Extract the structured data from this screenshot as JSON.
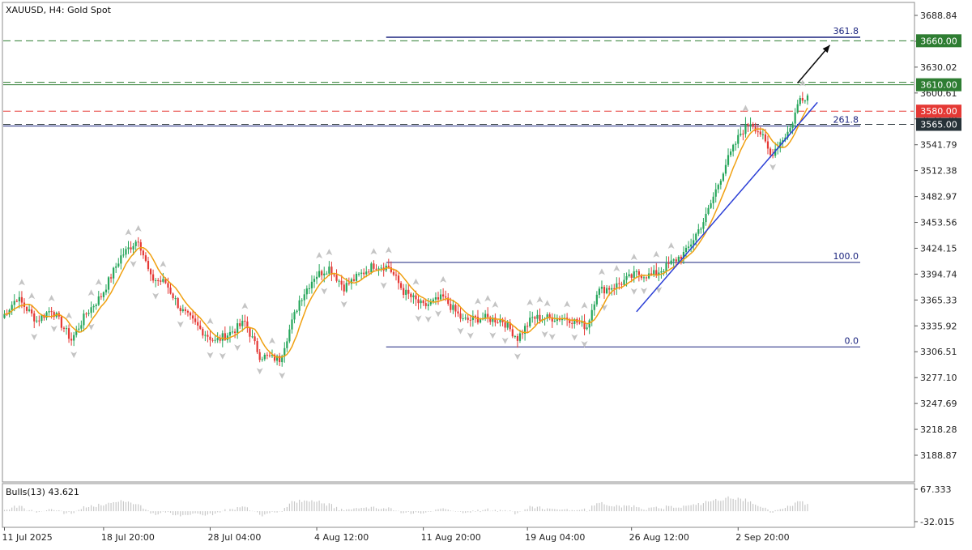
{
  "header": {
    "title": "XAUUSD, H4:  Gold Spot"
  },
  "colors": {
    "bull": "#26a65b",
    "bear": "#e53935",
    "ma": "#f0a010",
    "fib": "#1a237e",
    "trend": "#2b3fd6",
    "target": "#0a0a0a",
    "green_level": "#2e7d32",
    "red_level": "#e53935",
    "dark_level": "#263238",
    "histogram": "#c8c8c8",
    "fractal": "#c4c4c4"
  },
  "chart_data": {
    "type": "candlestick",
    "symbol": "XAUUSD",
    "timeframe": "H4",
    "title": "XAUUSD, H4:  Gold Spot",
    "ylim": [
      3170,
      3700
    ],
    "y_ticks": [
      "3688.84",
      "3659.43",
      "3630.02",
      "3600.61",
      "3571.20",
      "3541.79",
      "3512.38",
      "3482.97",
      "3453.56",
      "3424.15",
      "3394.74",
      "3365.33",
      "3335.92",
      "3306.51",
      "3277.10",
      "3247.69",
      "3218.28",
      "3188.87"
    ],
    "x_tick_labels": [
      "11 Jul 2025",
      "18 Jul 20:00",
      "28 Jul 04:00",
      "4 Aug 12:00",
      "11 Aug 20:00",
      "19 Aug 04:00",
      "26 Aug 12:00",
      "2 Sep 20:00"
    ],
    "x_tick_bar_index": [
      0,
      40,
      83,
      126,
      169,
      211,
      253,
      296
    ],
    "bar_count": 325,
    "anchors": [
      [
        0,
        3345
      ],
      [
        6,
        3368
      ],
      [
        14,
        3342
      ],
      [
        20,
        3355
      ],
      [
        28,
        3320
      ],
      [
        34,
        3350
      ],
      [
        40,
        3370
      ],
      [
        48,
        3415
      ],
      [
        55,
        3435
      ],
      [
        60,
        3390
      ],
      [
        66,
        3385
      ],
      [
        72,
        3355
      ],
      [
        80,
        3332
      ],
      [
        86,
        3318
      ],
      [
        92,
        3328
      ],
      [
        98,
        3340
      ],
      [
        104,
        3302
      ],
      [
        112,
        3298
      ],
      [
        120,
        3365
      ],
      [
        126,
        3392
      ],
      [
        132,
        3402
      ],
      [
        138,
        3380
      ],
      [
        144,
        3393
      ],
      [
        150,
        3405
      ],
      [
        156,
        3403
      ],
      [
        162,
        3375
      ],
      [
        170,
        3358
      ],
      [
        178,
        3368
      ],
      [
        186,
        3342
      ],
      [
        194,
        3345
      ],
      [
        202,
        3342
      ],
      [
        208,
        3322
      ],
      [
        214,
        3345
      ],
      [
        220,
        3345
      ],
      [
        228,
        3345
      ],
      [
        236,
        3335
      ],
      [
        240,
        3375
      ],
      [
        248,
        3382
      ],
      [
        256,
        3395
      ],
      [
        262,
        3393
      ],
      [
        268,
        3403
      ],
      [
        276,
        3420
      ],
      [
        284,
        3460
      ],
      [
        292,
        3520
      ],
      [
        298,
        3555
      ],
      [
        302,
        3568
      ],
      [
        306,
        3555
      ],
      [
        310,
        3530
      ],
      [
        314,
        3545
      ],
      [
        318,
        3560
      ],
      [
        322,
        3595
      ],
      [
        325,
        3598
      ],
      [
        326,
        3612
      ]
    ],
    "moving_average": {
      "name": "",
      "color": "#f0a010"
    },
    "fibonacci": {
      "levels": [
        {
          "label": "0.0",
          "price": 3312
        },
        {
          "label": "100.0",
          "price": 3408
        },
        {
          "label": "261.8",
          "price": 3563
        },
        {
          "label": "361.8",
          "price": 3664
        }
      ],
      "start_bar": 154,
      "end_bar": 345
    },
    "horizontal_levels": [
      {
        "label": "3660.00",
        "price": 3660,
        "style": "dashed",
        "color": "#2e7d32"
      },
      {
        "label": "3610.00",
        "price": 3610,
        "style": "solid",
        "color": "#2e7d32"
      },
      {
        "label": "3580.00",
        "price": 3580,
        "style": "dashed",
        "color": "#e53935"
      },
      {
        "label": "3565.00",
        "price": 3565,
        "style": "dashed",
        "color": "#263238"
      }
    ],
    "trendline": {
      "from": [
        255,
        3352
      ],
      "to": [
        328,
        3590
      ]
    },
    "target_arrow": {
      "from": [
        320,
        3612
      ],
      "to": [
        333,
        3655
      ]
    },
    "indicator": {
      "label": "Bulls(13) 43.621",
      "ylim": [
        -32.015,
        67.333
      ],
      "y_ticks": [
        "67.333",
        "-32.015"
      ]
    }
  }
}
